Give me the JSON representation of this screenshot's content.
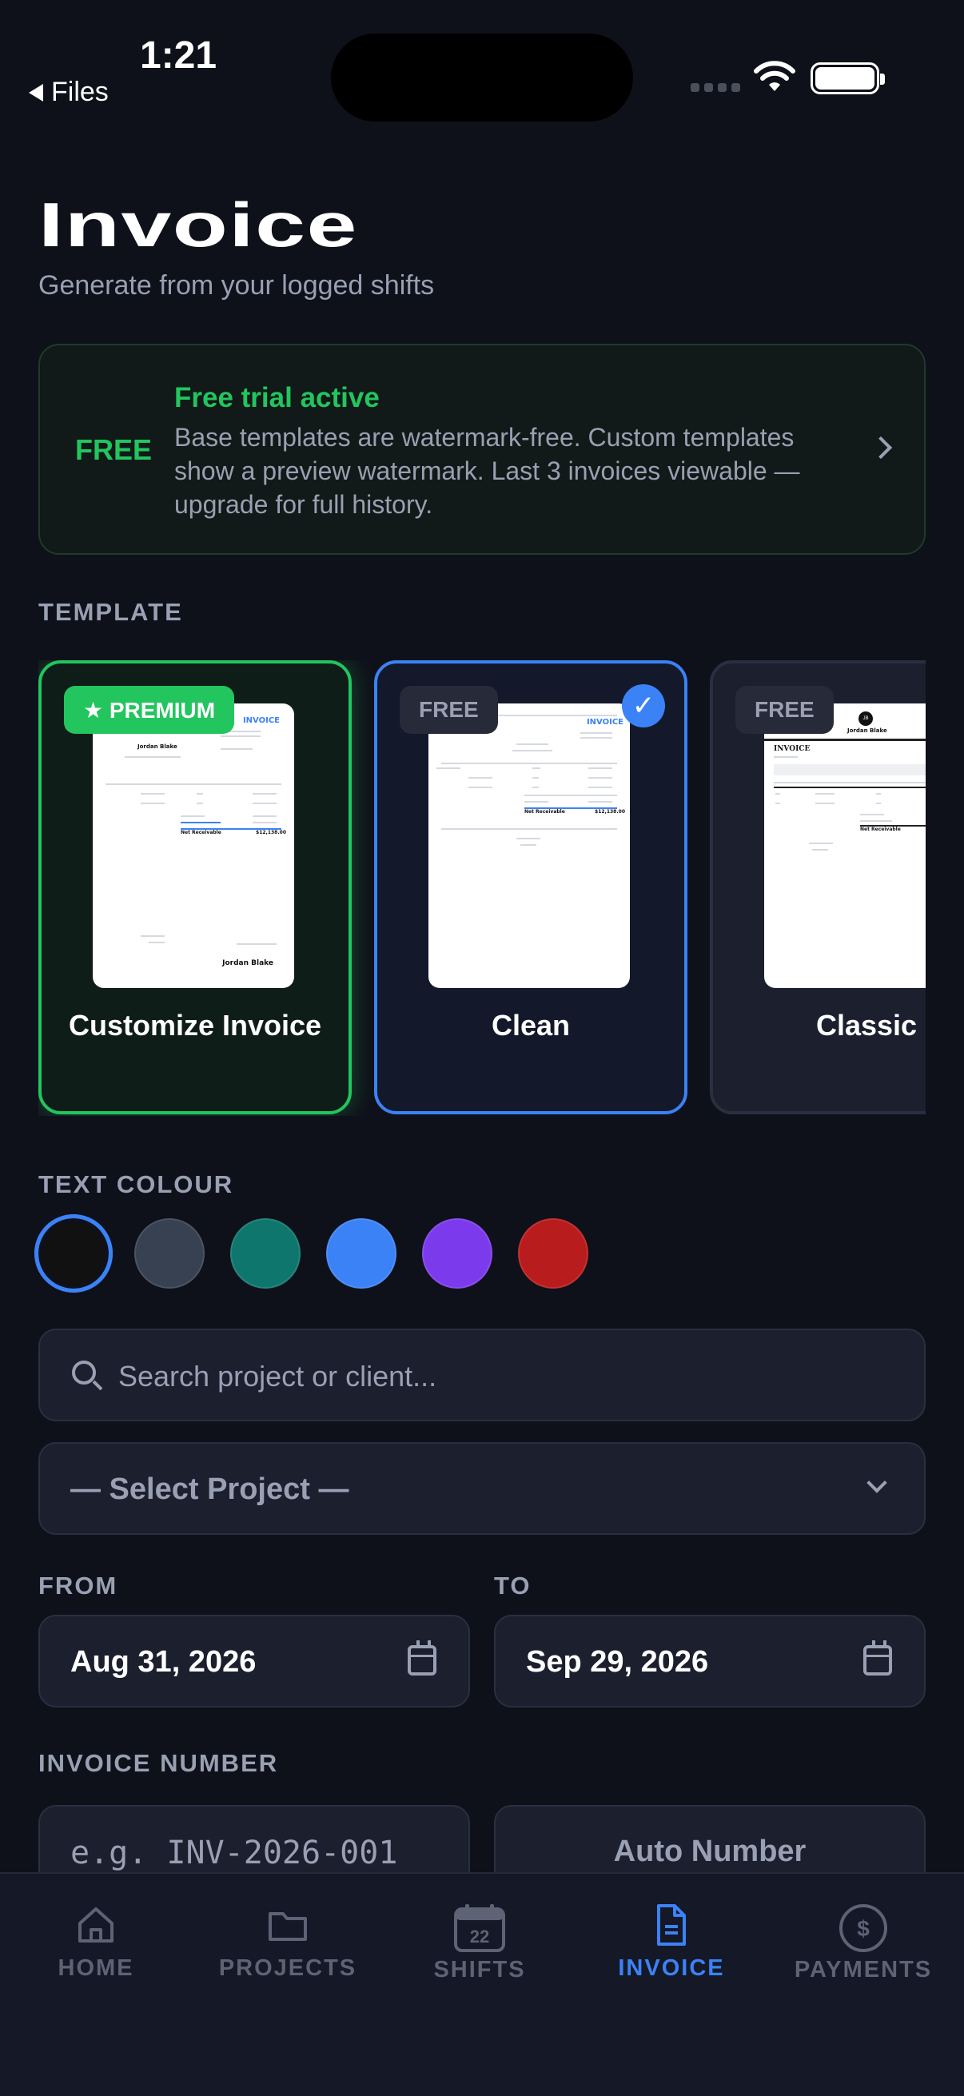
{
  "status_bar": {
    "time": "1:21",
    "back_label": "Files"
  },
  "header": {
    "title": "Invoice",
    "subtitle": "Generate from your logged shifts"
  },
  "trial": {
    "tag": "FREE",
    "title": "Free trial active",
    "body": "Base templates are watermark-free. Custom templates show a preview watermark. Last 3 invoices viewable — upgrade for full history."
  },
  "template": {
    "label": "TEMPLATE",
    "cards": [
      {
        "badge": "★ PREMIUM",
        "name": "Customize Invoice",
        "selected": false
      },
      {
        "badge": "FREE",
        "name": "Clean",
        "selected": true
      },
      {
        "badge": "FREE",
        "name": "Classic",
        "selected": false
      }
    ],
    "check_glyph": "✓"
  },
  "preview_text": {
    "invoice": "INVOICE",
    "client_name": "Jordan Blake",
    "net_receivable": "Net Receivable",
    "total": "$12,138.00",
    "monogram": "JB",
    "classic_heading": "INVOICE"
  },
  "text_colour": {
    "label": "TEXT COLOUR",
    "swatches": [
      "#111111",
      "#374151",
      "#0f766e",
      "#3b82f6",
      "#7c3aed",
      "#b91c1c"
    ],
    "selected_index": 0
  },
  "search": {
    "placeholder": "Search project or client..."
  },
  "project_select": {
    "value": "— Select Project —"
  },
  "dates": {
    "from_label": "FROM",
    "from_value": "Aug 31, 2026",
    "to_label": "TO",
    "to_value": "Sep 29, 2026"
  },
  "invoice_number": {
    "label": "INVOICE NUMBER",
    "placeholder": "e.g. INV-2026-001",
    "auto_label": "Auto Number"
  },
  "tabs": [
    {
      "label": "HOME",
      "icon": "home-icon",
      "active": false
    },
    {
      "label": "PROJECTS",
      "icon": "folder-icon",
      "active": false
    },
    {
      "label": "SHIFTS",
      "icon": "calendar-icon",
      "badge": "22",
      "active": false
    },
    {
      "label": "INVOICE",
      "icon": "document-icon",
      "active": true
    },
    {
      "label": "PAYMENTS",
      "icon": "dollar-icon",
      "active": false
    }
  ],
  "colors": {
    "accent": "#3b82f6",
    "success": "#22c55e",
    "background": "#0f111a",
    "card": "#1b1f2e"
  }
}
